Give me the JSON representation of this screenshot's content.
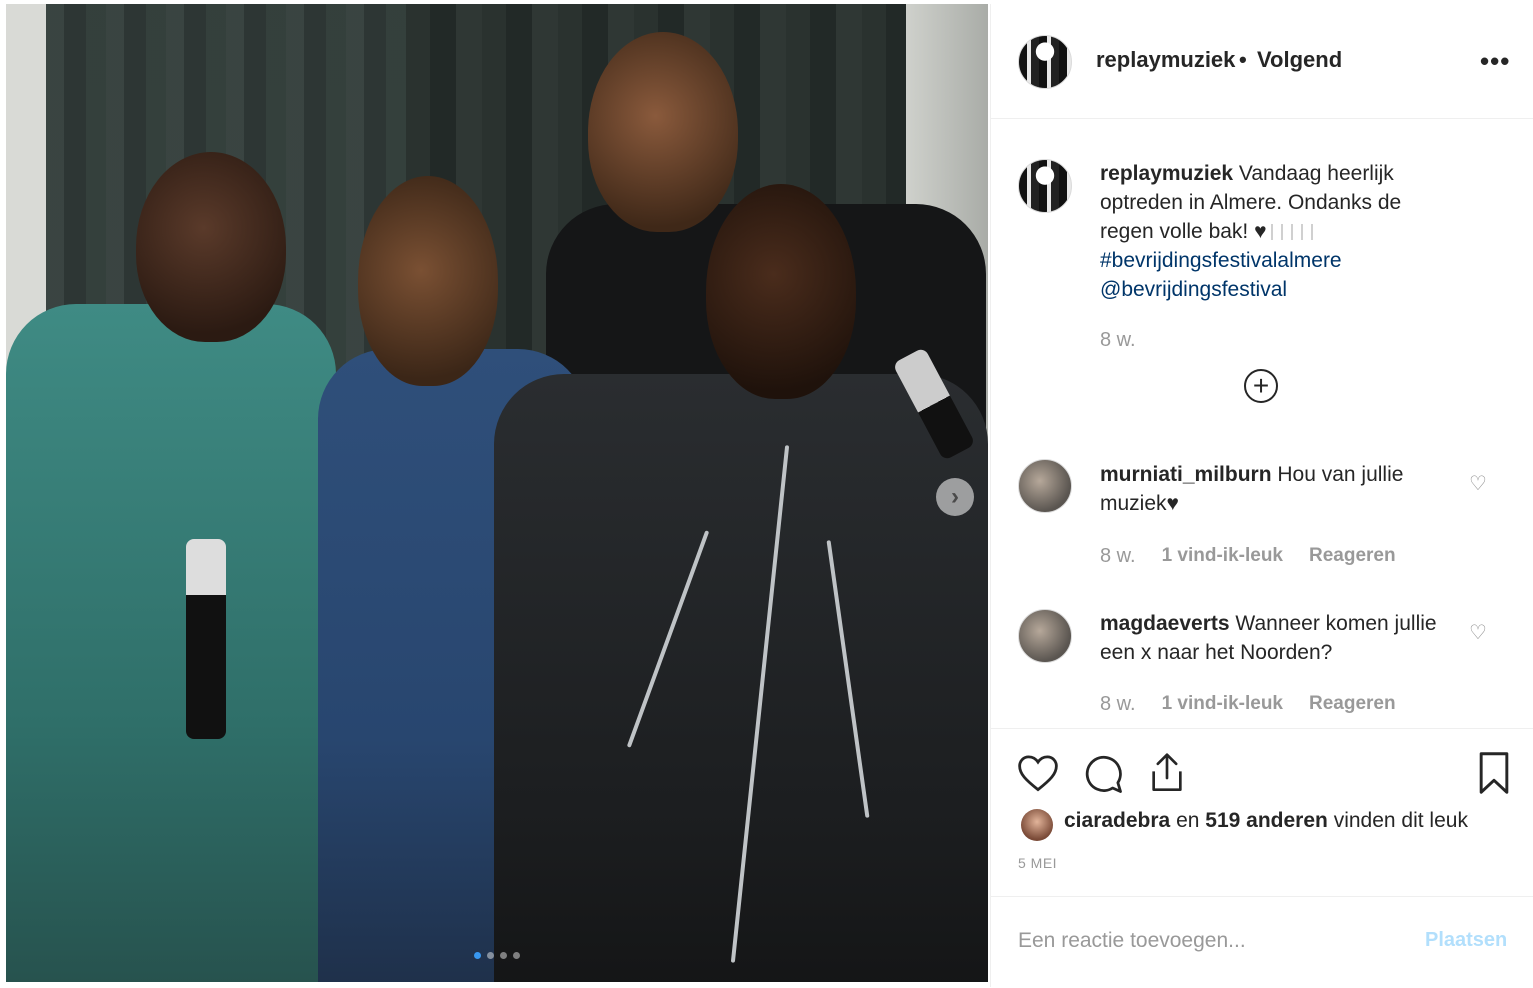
{
  "post": {
    "username": "replaymuziek",
    "separator": "•",
    "follow_status": "Volgend",
    "more_icon": "•••",
    "photo_next_icon": "›"
  },
  "caption": {
    "username": "replaymuziek",
    "text": "Vandaag heerlijk optreden in Almere. Ondanks de regen volle bak! ♥",
    "hashtag": "#bevrijdingsfestivalalmere",
    "mention": "@bevrijdingsfestival",
    "time": "8 w.",
    "load_more_icon": "+"
  },
  "comments": [
    {
      "username": "murniati_milburn",
      "text": "Hou van jullie muziek♥",
      "time": "8 w.",
      "likes": "1 vind-ik-leuk",
      "reply": "Reageren"
    },
    {
      "username": "magdaeverts",
      "text": "Wanneer komen jullie een x naar het Noorden?",
      "time": "8 w.",
      "likes": "1 vind-ik-leuk",
      "reply": "Reageren"
    }
  ],
  "likes": {
    "first_user": "ciaradebra",
    "connector": "en",
    "others": "519 anderen",
    "suffix": "vinden dit leuk"
  },
  "date": "5 MEI",
  "add_comment": {
    "placeholder": "Een reactie toevoegen...",
    "post_label": "Plaatsen"
  },
  "colors": {
    "link": "#003569",
    "muted": "#999999",
    "post_disabled": "#b2dffc",
    "carousel_active": "#3897f0"
  },
  "icons": [
    "heart-icon",
    "comment-icon",
    "share-icon",
    "bookmark-icon",
    "chevron-right-icon",
    "plus-circle-icon",
    "more-icon"
  ]
}
